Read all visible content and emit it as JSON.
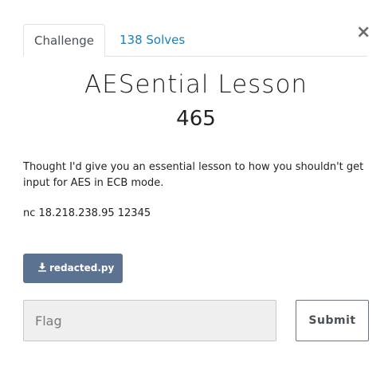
{
  "tabs": [
    {
      "label": "Challenge",
      "active": true
    },
    {
      "label": "138 Solves",
      "active": false
    }
  ],
  "close_label": "×",
  "challenge": {
    "name": "AESential Lesson",
    "points": "465",
    "description": "Thought I'd give you an essential lesson to how you shouldn't get input for AES in ECB mode.",
    "connection": "nc 18.218.238.95 12345"
  },
  "file": {
    "label": "redacted.py",
    "icon": "download-icon"
  },
  "flag": {
    "placeholder": "Flag",
    "value": ""
  },
  "submit_label": "Submit",
  "colors": {
    "link": "#1e7eb8",
    "download_button": "#5b7290",
    "input_bg": "#efefef"
  }
}
